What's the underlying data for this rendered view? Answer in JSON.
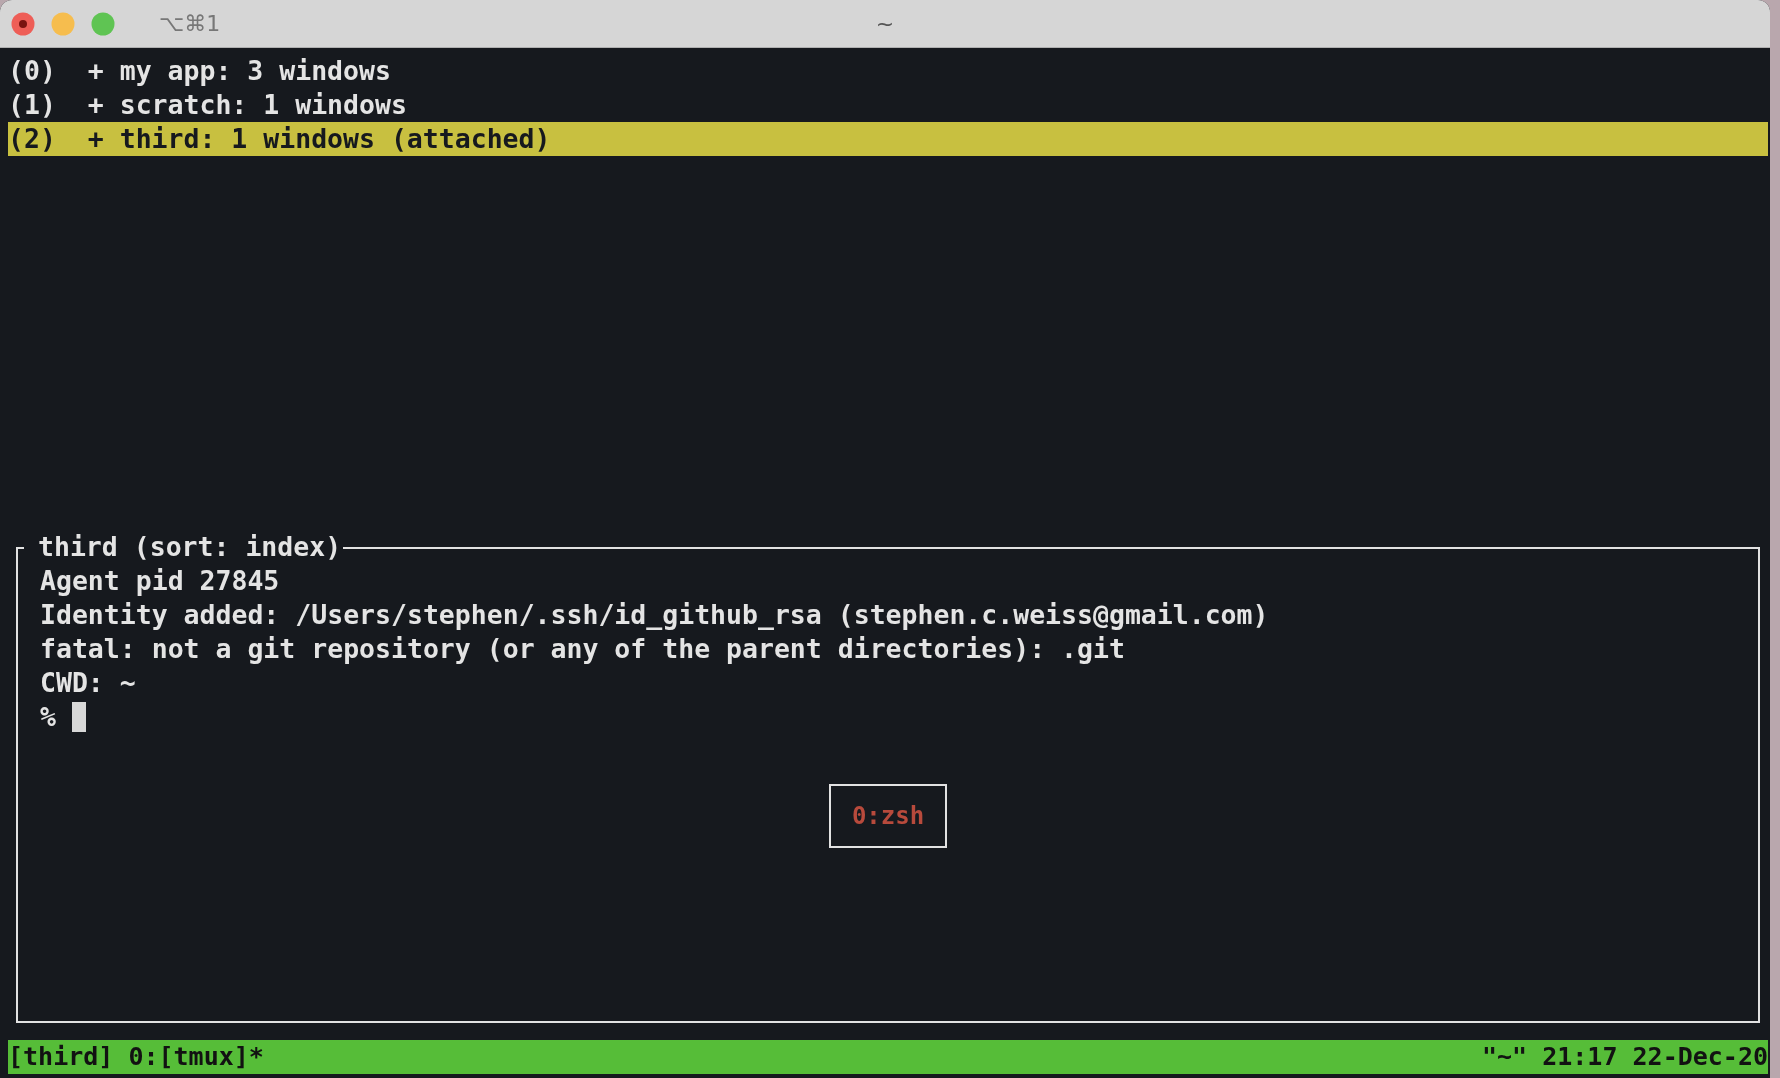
{
  "window": {
    "shortcut": "⌥⌘1",
    "title": "~"
  },
  "sessions": [
    {
      "label": "(0)  + my app: 3 windows",
      "selected": false
    },
    {
      "label": "(1)  + scratch: 1 windows",
      "selected": false
    },
    {
      "label": "(2)  + third: 1 windows (attached)",
      "selected": true
    }
  ],
  "preview": {
    "title": "third (sort: index)",
    "lines": [
      "Agent pid 27845",
      "Identity added: /Users/stephen/.ssh/id_github_rsa (stephen.c.weiss@gmail.com)",
      "fatal: not a git repository (or any of the parent directories): .git",
      "CWD: ~"
    ],
    "prompt": "%",
    "window_label": "0:zsh"
  },
  "status_bar": {
    "left": "[third] 0:[tmux]*",
    "right": "\"~\" 21:17 22-Dec-20"
  }
}
